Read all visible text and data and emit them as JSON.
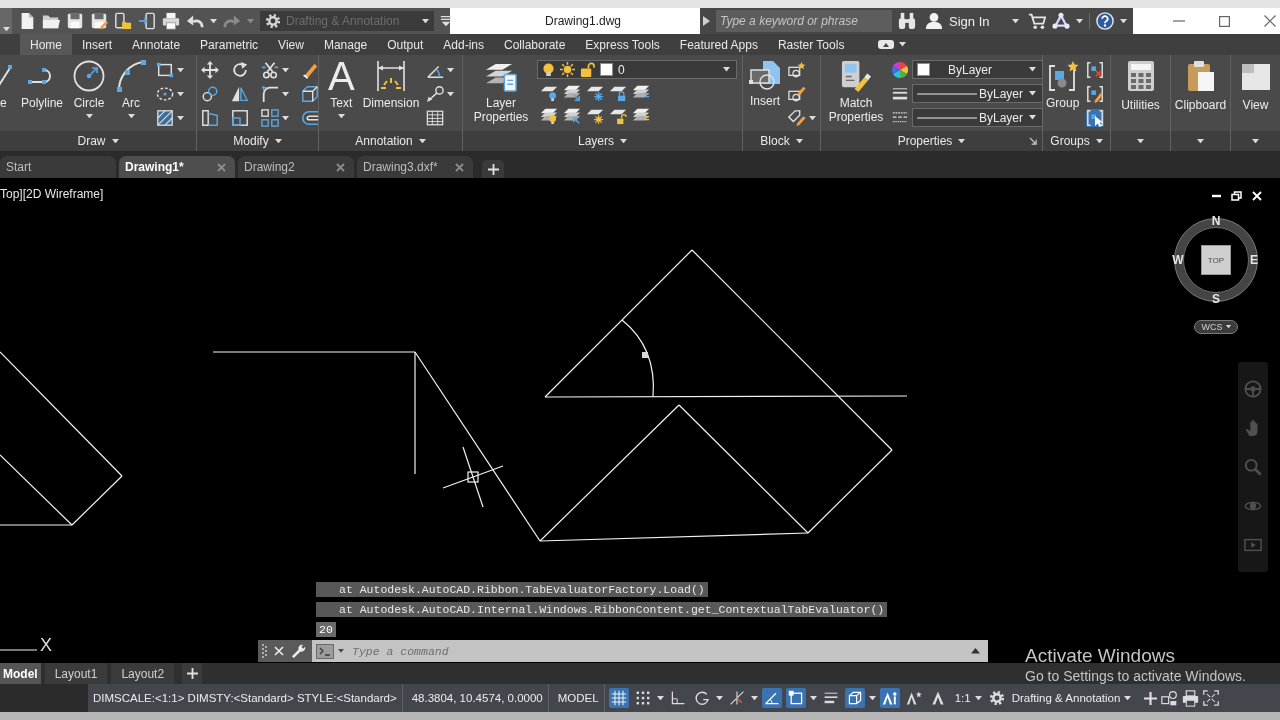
{
  "quick_access": {
    "history": [
      {
        "kind": "undo",
        "disabled": false
      },
      {
        "kind": "redo",
        "disabled": true
      }
    ],
    "workspace": {
      "label": "Drafting & Annotation",
      "disabled": true
    }
  },
  "window": {
    "title": "Drawing1.dwg"
  },
  "search": {
    "placeholder": "Type a keyword or phrase"
  },
  "account": {
    "label": "Sign In"
  },
  "ribbon": {
    "tabs": [
      {
        "label": "Home",
        "selected": true
      },
      {
        "label": "Insert",
        "selected": false
      },
      {
        "label": "Annotate",
        "selected": false
      },
      {
        "label": "Parametric",
        "selected": false
      },
      {
        "label": "View",
        "selected": false
      },
      {
        "label": "Manage",
        "selected": false
      },
      {
        "label": "Output",
        "selected": false
      },
      {
        "label": "Add-ins",
        "selected": false
      },
      {
        "label": "Collaborate",
        "selected": false
      },
      {
        "label": "Express Tools",
        "selected": false
      },
      {
        "label": "Featured Apps",
        "selected": false
      },
      {
        "label": "Raster Tools",
        "selected": false
      }
    ],
    "panels": [
      {
        "title": "Draw",
        "items": [
          {
            "label": "e"
          },
          {
            "label": "Polyline"
          },
          {
            "label": "Circle"
          },
          {
            "label": "Arc"
          }
        ]
      },
      {
        "title": "Modify"
      },
      {
        "title": "Annotation",
        "items": [
          {
            "label": "Text",
            "glyph": "A"
          },
          {
            "label": "Dimension"
          }
        ]
      },
      {
        "title": "Layers",
        "items": [
          {
            "label": "Layer Properties"
          }
        ],
        "current_layer": "0"
      },
      {
        "title": "Block",
        "items": [
          {
            "label": "Insert"
          }
        ]
      },
      {
        "title": "Properties",
        "items": [
          {
            "label": "Match Properties"
          }
        ],
        "color_control": "ByLayer",
        "lineweight_control": "ByLayer",
        "linetype_control": "ByLayer"
      },
      {
        "title": "Groups",
        "items": [
          {
            "label": "Group"
          }
        ],
        "selection_toggle": {
          "on": true
        }
      }
    ],
    "collapsed_panels": [
      {
        "label": "Utilities"
      },
      {
        "label": "Clipboard"
      },
      {
        "label": "View"
      }
    ]
  },
  "file_tabs": [
    {
      "label": "Start",
      "selected": false,
      "closable": false
    },
    {
      "label": "Drawing1*",
      "selected": true,
      "closable": true
    },
    {
      "label": "Drawing2",
      "selected": false,
      "closable": true
    },
    {
      "label": "Drawing3.dxf*",
      "selected": false,
      "closable": true
    }
  ],
  "viewport": {
    "label": "Top][2D Wireframe]",
    "viewcube": {
      "north": "N",
      "west": "W",
      "face": "TOP",
      "east": "E",
      "south": "S",
      "ucs_menu": "WCS"
    },
    "ucs_label": "X"
  },
  "command_line": {
    "history": [
      {
        "kind": "trace",
        "text": "at Autodesk.AutoCAD.Ribbon.TabEvaluatorFactory.Load()"
      },
      {
        "kind": "trace",
        "text": "at Autodesk.AutoCAD.Internal.Windows.RibbonContent.get_ContextualTabEvaluator()"
      },
      {
        "kind": "input",
        "text": "20"
      }
    ],
    "placeholder": "Type a command"
  },
  "layout_tabs": [
    {
      "label": "Model",
      "selected": true
    },
    {
      "label": "Layout1",
      "selected": false
    },
    {
      "label": "Layout2",
      "selected": false
    }
  ],
  "status_bar": {
    "info": "DIMSCALE:<1:1> DIMSTY:<Standard> STYLE:<Standard>",
    "coordinates": "48.3804, 10.4574, 0.0000",
    "space": "MODEL",
    "toggles": [
      {
        "on": true
      },
      {
        "on": false
      },
      {
        "on": false
      },
      {
        "on": false
      },
      {
        "on": false
      },
      {
        "on": true
      },
      {
        "on": true
      },
      {
        "on": false
      },
      {
        "on": true
      },
      {
        "on": true
      },
      {
        "on": false
      },
      {
        "on": false
      }
    ],
    "annotation_scale": "1:1",
    "workspace": "Drafting & Annotation"
  },
  "activation_notice": {
    "title": "Activate Windows",
    "message": "Go to Settings to activate Windows."
  }
}
